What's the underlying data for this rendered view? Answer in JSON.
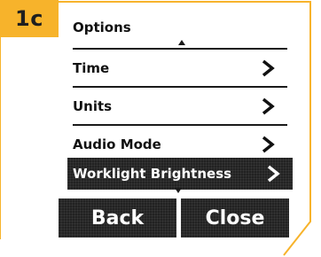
{
  "badge": {
    "label": "1c"
  },
  "menu": {
    "title": "Options",
    "items": [
      {
        "label": "Time"
      },
      {
        "label": "Units"
      },
      {
        "label": "Audio Mode"
      },
      {
        "label": "Worklight Brightness",
        "selected": true
      }
    ]
  },
  "buttons": {
    "back": "Back",
    "close": "Close"
  },
  "colors": {
    "badge": "#f7b32b",
    "accent_line": "#f7b32b",
    "selected_bg": "#222222"
  }
}
